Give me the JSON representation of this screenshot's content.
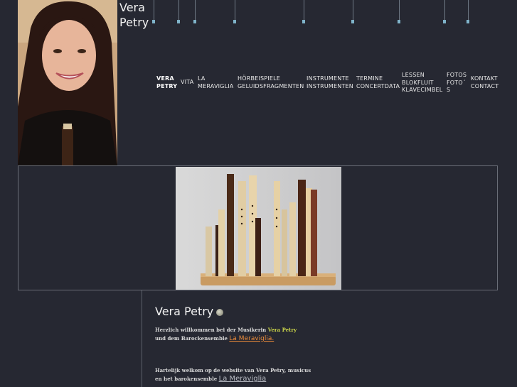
{
  "site": {
    "name_line1": "Vera",
    "name_line2": "Petry"
  },
  "nav": [
    {
      "line1": "VERA",
      "line2": "PETRY",
      "line3": ""
    },
    {
      "line1": "VITA",
      "line2": "",
      "line3": ""
    },
    {
      "line1": "LA",
      "line2": "MERAVIGLIA",
      "line3": ""
    },
    {
      "line1": "HÖRBEISPIELE",
      "line2": "GELUIDSFRAGMENTEN",
      "line3": ""
    },
    {
      "line1": "INSTRUMENTE",
      "line2": "INSTRUMENTEN",
      "line3": ""
    },
    {
      "line1": "TERMINE",
      "line2": "CONCERTDATA",
      "line3": ""
    },
    {
      "line1": "LESSEN",
      "line2": "BLOKFLUIT",
      "line3": "KLAVECIMBEL"
    },
    {
      "line1": "FOTOS",
      "line2": "FOTO´",
      "line3": "S"
    },
    {
      "line1": "KONTAKT",
      "line2": "CONTACT",
      "line3": ""
    }
  ],
  "content": {
    "title": "Vera Petry",
    "de_text_1": "Herzlich willkommen bei der Musikerin",
    "de_name": "Vera Petry",
    "de_text_2": "und dem Barockensemble",
    "de_link": "La Meraviglia.",
    "nl_text_1": "Hartelijk welkom op de website van Vera Petry, musicus",
    "nl_text_2": "en het barokensemble",
    "nl_link": "La Meraviglia"
  },
  "colors": {
    "background": "#262832",
    "highlight_green": "#c9d34a",
    "link_orange": "#e98a3a"
  }
}
